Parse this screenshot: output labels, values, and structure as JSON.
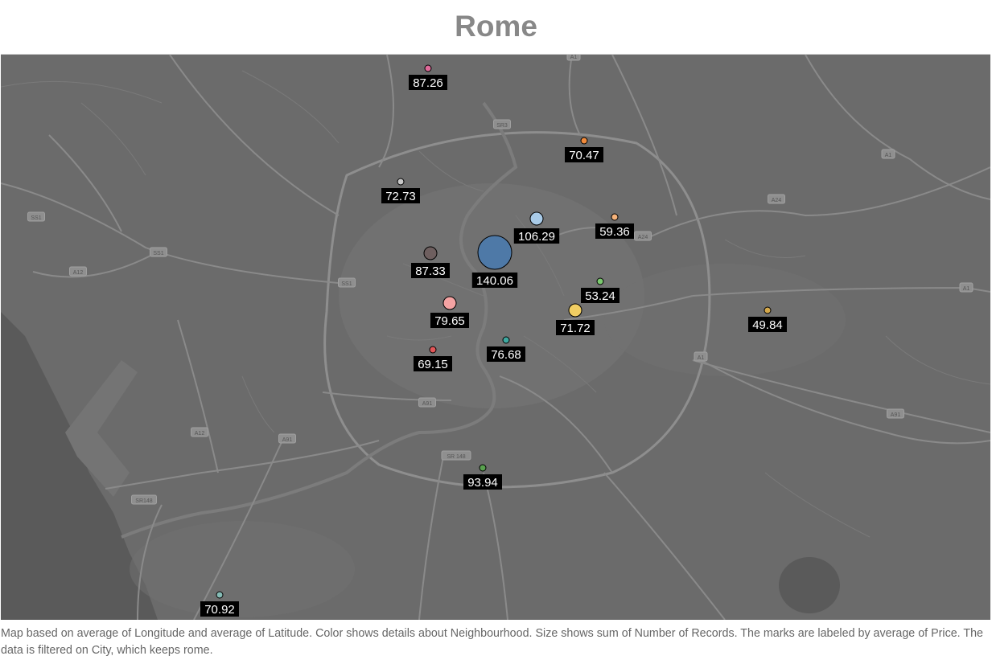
{
  "title": "Rome",
  "caption": "Map based on average of Longitude and average of Latitude.  Color shows details about Neighbourhood.  Size shows sum of Number of Records.  The marks are labeled by average of Price. The data is filtered on City, which keeps rome.",
  "colors": {
    "map_background": "#6b6b6b",
    "roads": "#8a8a8a",
    "label_background": "#000000",
    "label_text": "#ffffff",
    "title": "#888888"
  },
  "road_labels": [
    "SR3",
    "A1",
    "A1",
    "A24",
    "A24",
    "SS1",
    "SS1",
    "SS1",
    "A12",
    "A12",
    "A1",
    "A1",
    "A91",
    "A91",
    "A91",
    "SR148",
    "SR 148"
  ],
  "chart_data": {
    "type": "map",
    "marks": [
      {
        "price_label": "87.26",
        "color": "#e06a9a",
        "records": "small"
      },
      {
        "price_label": "70.47",
        "color": "#f08a3b",
        "records": "small"
      },
      {
        "price_label": "72.73",
        "color": "#c8c8c8",
        "records": "small"
      },
      {
        "price_label": "106.29",
        "color": "#a9cbe8",
        "records": "medium"
      },
      {
        "price_label": "59.36",
        "color": "#f5b27a",
        "records": "small"
      },
      {
        "price_label": "87.33",
        "color": "#6e5f5f",
        "records": "medium"
      },
      {
        "price_label": "140.06",
        "color": "#4e79a7",
        "records": "large"
      },
      {
        "price_label": "53.24",
        "color": "#7bc96f",
        "records": "small"
      },
      {
        "price_label": "71.72",
        "color": "#f1ce63",
        "records": "medium"
      },
      {
        "price_label": "49.84",
        "color": "#d4a84b",
        "records": "small"
      },
      {
        "price_label": "79.65",
        "color": "#f4a3a3",
        "records": "medium"
      },
      {
        "price_label": "76.68",
        "color": "#3ea8a0",
        "records": "small"
      },
      {
        "price_label": "69.15",
        "color": "#e15759",
        "records": "small"
      },
      {
        "price_label": "93.94",
        "color": "#59a14f",
        "records": "small"
      },
      {
        "price_label": "70.92",
        "color": "#86bcb6",
        "records": "small"
      }
    ]
  }
}
